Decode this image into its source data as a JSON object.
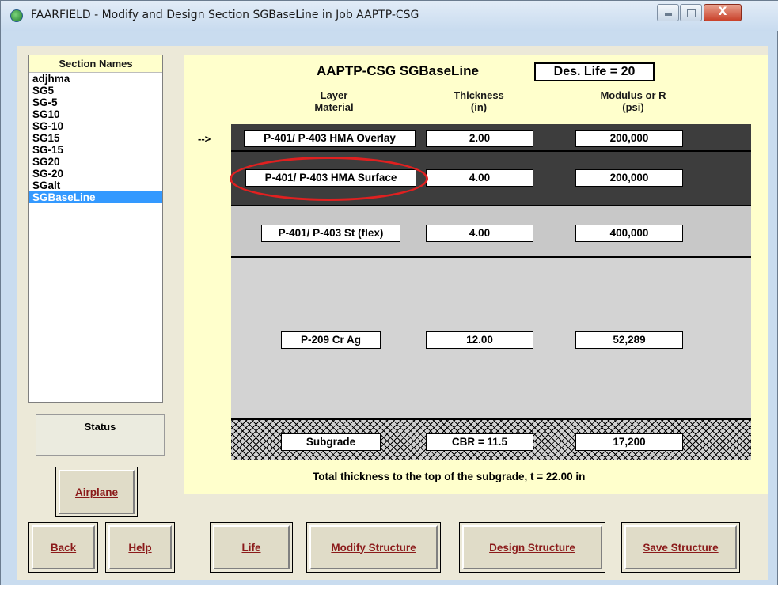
{
  "window": {
    "title": "FAARFIELD - Modify and Design Section SGBaseLine in Job AAPTP-CSG",
    "close_glyph": "X",
    "icon": "faarfield-app-icon"
  },
  "sections": {
    "header": "Section Names",
    "items": [
      "adjhma",
      "SG5",
      "SG-5",
      "SG10",
      "SG-10",
      "SG15",
      "SG-15",
      "SG20",
      "SG-20",
      "SGalt",
      "SGBaseLine"
    ],
    "selected": "SGBaseLine"
  },
  "status": {
    "label": "Status"
  },
  "main": {
    "heading": "AAPTP-CSG  SGBaseLine",
    "des_life": "Des. Life = 20",
    "columns": {
      "layer": "Layer\nMaterial",
      "thickness": "Thickness\n(in)",
      "modulus": "Modulus or R\n(psi)"
    },
    "arrow": "-->",
    "layers": [
      {
        "material": "P-401/ P-403 HMA Overlay",
        "thickness": "2.00",
        "modulus": "200,000"
      },
      {
        "material": "P-401/ P-403 HMA Surface",
        "thickness": "4.00",
        "modulus": "200,000"
      },
      {
        "material": "P-401/ P-403 St (flex)",
        "thickness": "4.00",
        "modulus": "400,000"
      },
      {
        "material": "P-209 Cr Ag",
        "thickness": "12.00",
        "modulus": "52,289"
      }
    ],
    "subgrade": {
      "material": "Subgrade",
      "cbr": "CBR = 11.5",
      "modulus": "17,200"
    },
    "total": "Total thickness to the top of the subgrade, t = 22.00 in"
  },
  "buttons": {
    "airplane": "Airplane",
    "back": "Back",
    "help": "Help",
    "life": "Life",
    "modify": "Modify Structure",
    "design": "Design Structure",
    "save": "Save Structure"
  },
  "colors": {
    "panel_bg": "#ffffcc",
    "dark_layer": "#3d3d3d",
    "light_layer": "#c8c8c8",
    "selection": "#3399ff",
    "button_text": "#8b1a1a",
    "highlight": "#e02020"
  }
}
